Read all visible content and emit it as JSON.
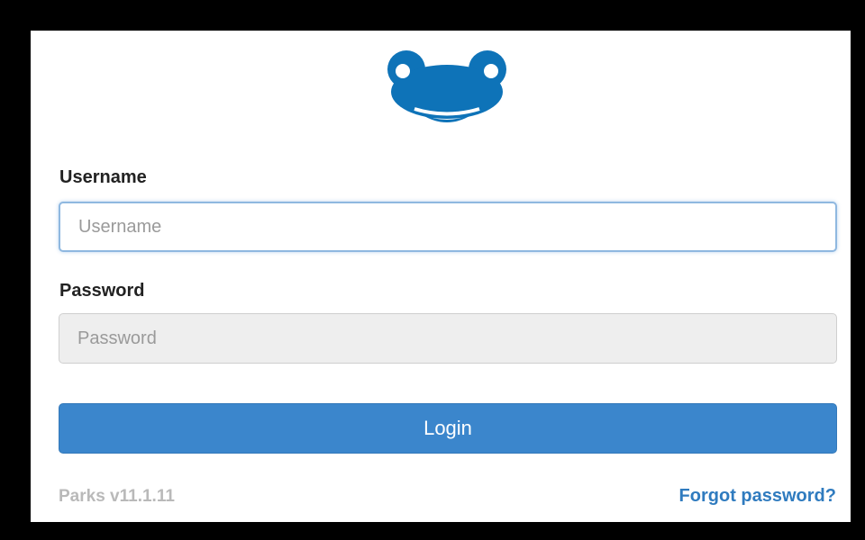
{
  "logo": {
    "icon": "frog-face-icon",
    "color": "#0e73b8"
  },
  "form": {
    "username_label": "Username",
    "username_placeholder": "Username",
    "username_value": "",
    "password_label": "Password",
    "password_placeholder": "Password",
    "password_value": "",
    "login_label": "Login"
  },
  "footer": {
    "version": "Parks v11.1.11",
    "forgot_password": "Forgot password?"
  },
  "colors": {
    "brand": "#0e73b8",
    "button": "#3b86cc",
    "link": "#2f7bbf"
  }
}
